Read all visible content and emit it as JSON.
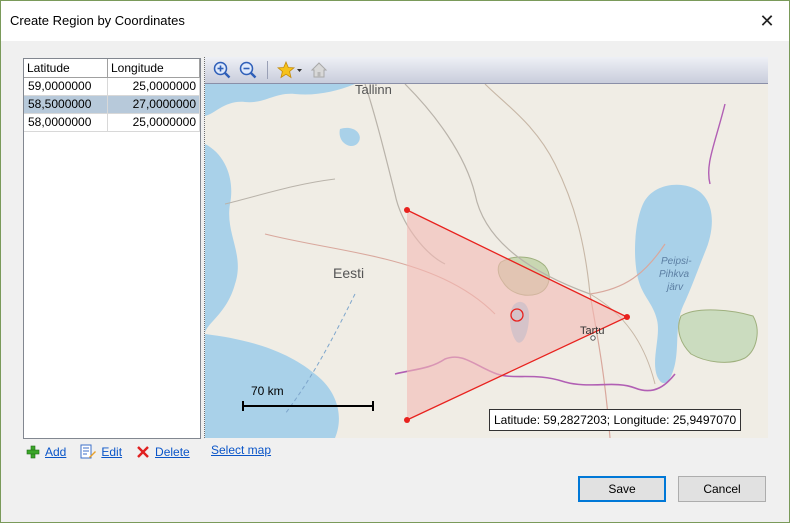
{
  "window": {
    "title": "Create Region by Coordinates",
    "close_glyph": "✕"
  },
  "grid": {
    "headers": [
      "Latitude",
      "Longitude"
    ],
    "rows": [
      {
        "lat": "59,0000000",
        "lon": "25,0000000",
        "selected": false
      },
      {
        "lat": "58,5000000",
        "lon": "27,0000000",
        "selected": true
      },
      {
        "lat": "58,0000000",
        "lon": "25,0000000",
        "selected": false
      }
    ]
  },
  "actions": {
    "add_label": "Add",
    "edit_label": "Edit",
    "delete_label": "Delete",
    "select_map_label": "Select map"
  },
  "map": {
    "toolbar_icons": [
      "zoom-in-icon",
      "zoom-out-icon",
      "favorites-star-icon",
      "home-icon"
    ],
    "labels": {
      "tallinn": "Tallinn",
      "eesti": "Eesti",
      "tartu": "Tartu",
      "lake_line1": "Peipsi-",
      "lake_line2": "Pihkva",
      "lake_line3": "järv"
    },
    "scale_label": "70 km",
    "coordinate_readout": "Latitude: 59,2827203; Longitude: 25,9497070",
    "colors": {
      "polygon_stroke": "#e8221e",
      "polygon_fill": "#f4b9b4",
      "water": "#a9d1e9",
      "land": "#f0ede5",
      "border": "#b15fb4"
    }
  },
  "buttons": {
    "save_label": "Save",
    "cancel_label": "Cancel"
  }
}
